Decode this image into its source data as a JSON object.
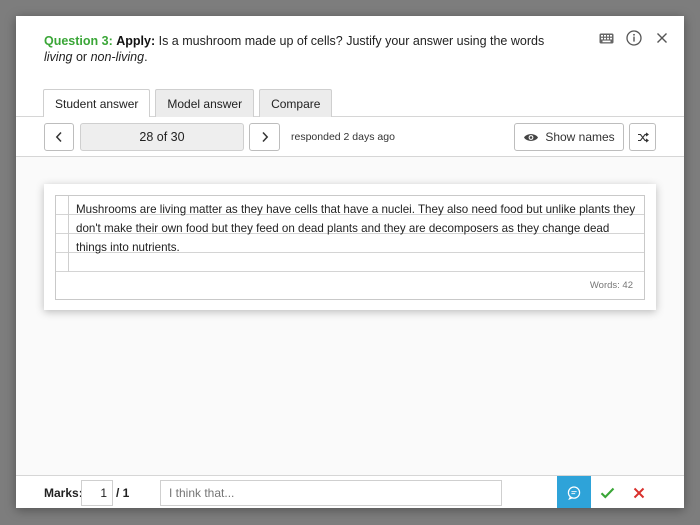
{
  "question": {
    "number": "Question 3:",
    "type": "Apply:",
    "text_before": " Is a mushroom made up of cells? Justify your answer using the words ",
    "word1": "living",
    "text_mid": " or ",
    "word2": "non-living",
    "text_after": "."
  },
  "tabs": [
    {
      "label": "Student answer",
      "active": true
    },
    {
      "label": "Model answer",
      "active": false
    },
    {
      "label": "Compare",
      "active": false
    }
  ],
  "pager": {
    "display": "28 of 30",
    "responded": "responded 2 days ago"
  },
  "show_names_label": "Show names",
  "answer": {
    "text": "Mushrooms are living matter as they have cells that have a nuclei. They also need food but unlike plants they don't make their own food but they feed on dead plants and they are decomposers as they change dead things into nutrients.",
    "words": "Words: 42"
  },
  "footer": {
    "marks_label": "Marks:",
    "marks_value": "1",
    "marks_total": "/ 1",
    "feedback_placeholder": "I think that..."
  },
  "colors": {
    "question_accent": "#3aa637",
    "comment_button": "#2ea3d9",
    "tick": "#3aa637",
    "cross": "#d9302c"
  },
  "icons": [
    "keyboard-icon",
    "info-icon",
    "close-icon",
    "chevron-left-icon",
    "chevron-right-icon",
    "eye-icon",
    "shuffle-icon",
    "comment-icon",
    "check-icon",
    "cross-icon"
  ]
}
